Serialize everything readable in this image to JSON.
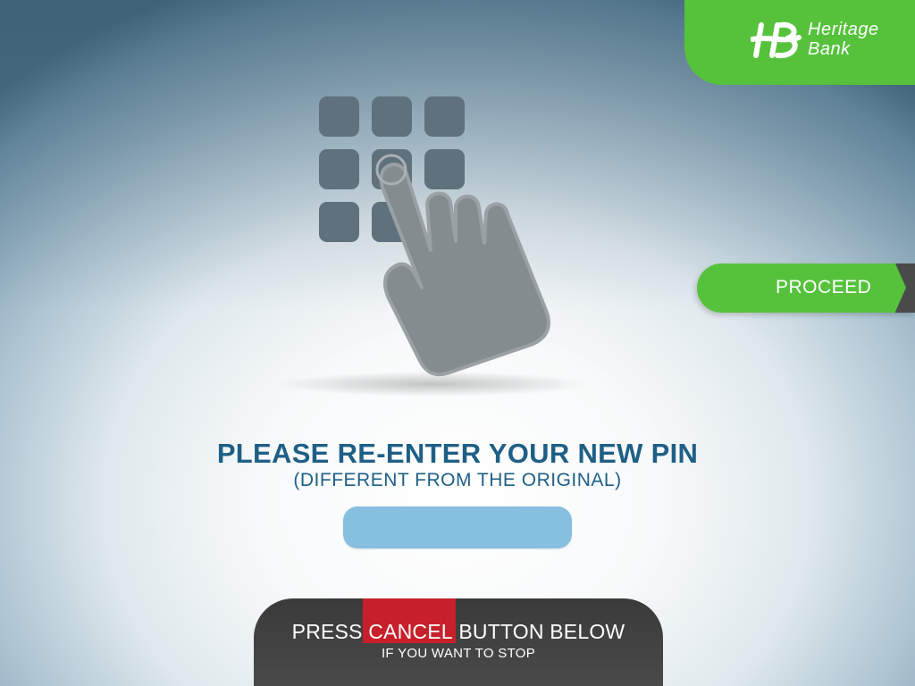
{
  "brand": {
    "name_line1": "Heritage",
    "name_line2": "Bank",
    "logo_mark": "HB",
    "color": "#56c23c"
  },
  "proceed_button": {
    "label": "PROCEED"
  },
  "prompt": {
    "title": "PLEASE RE-ENTER YOUR NEW PIN",
    "subtitle": "(DIFFERENT FROM THE ORIGINAL)"
  },
  "pin_input": {
    "value": "",
    "placeholder": ""
  },
  "cancel_notice": {
    "before": "PRESS ",
    "highlight": "CANCEL",
    "after": " BUTTON BELOW",
    "subtext": "IF YOU WANT TO STOP"
  },
  "illustration": {
    "icon": "keypad-press-icon"
  },
  "colors": {
    "accent_green": "#56c23c",
    "title_blue": "#1f5f86",
    "input_blue": "#86bfe0",
    "cancel_red": "#c8202a",
    "bar_dark": "#3f3f3f"
  }
}
